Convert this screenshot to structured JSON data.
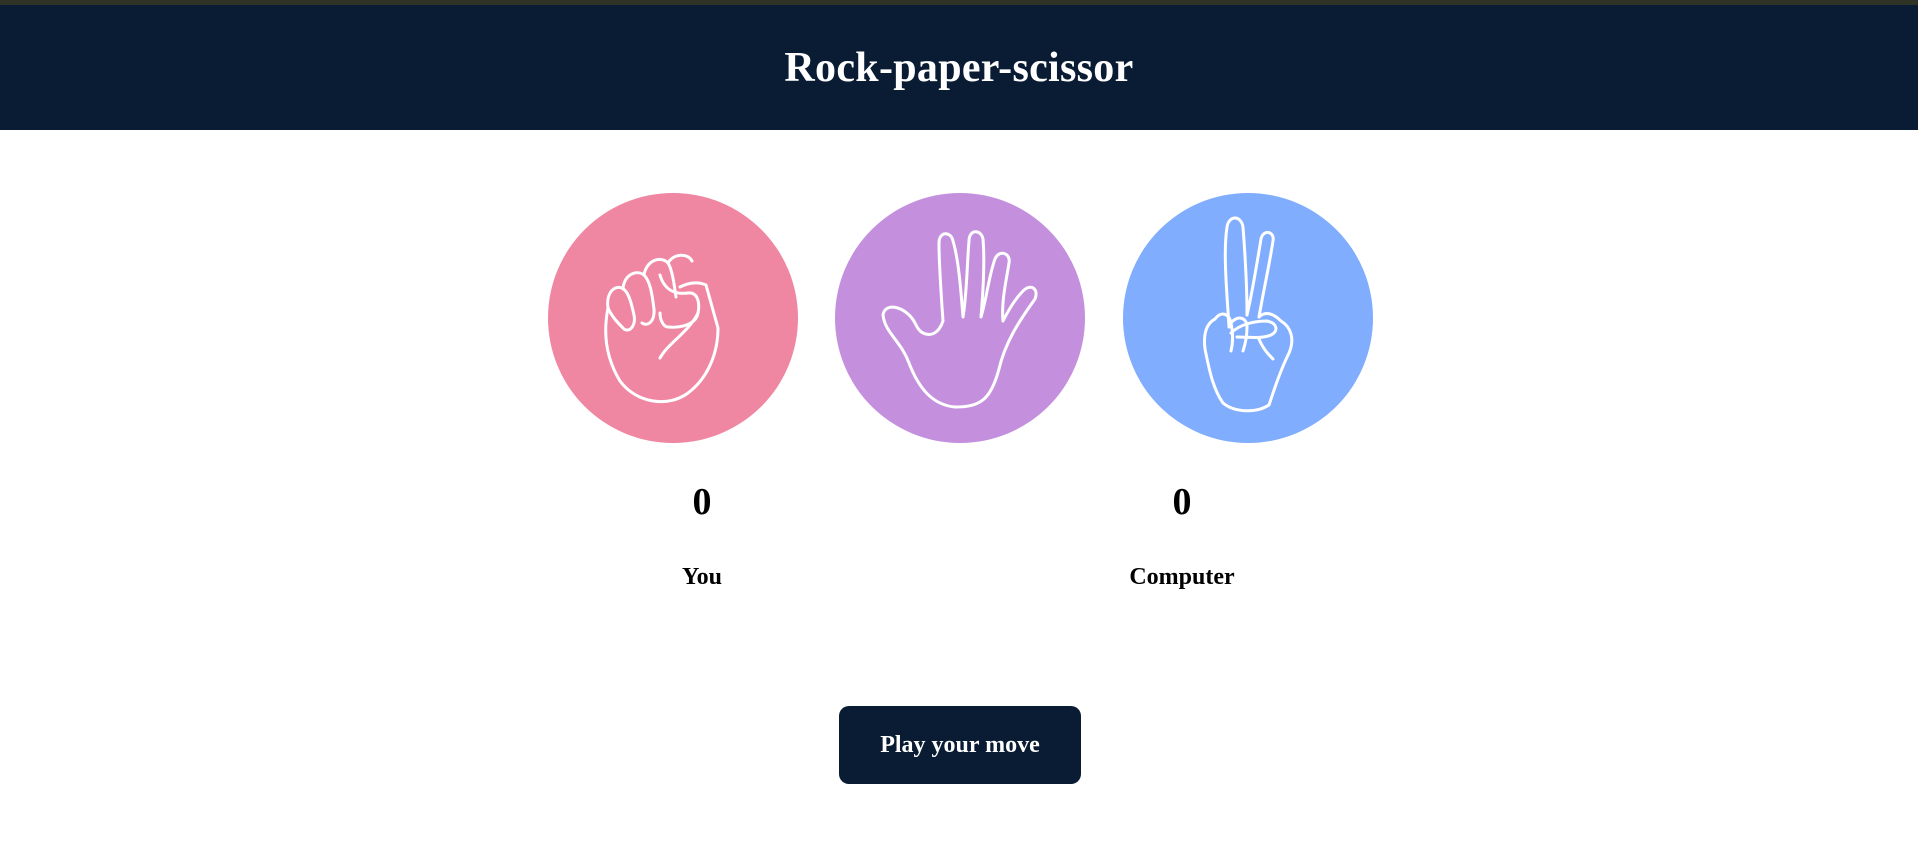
{
  "header": {
    "title": "Rock-paper-scissor"
  },
  "choices": [
    {
      "name": "rock",
      "icon": "fist-icon",
      "color": "#f087a2"
    },
    {
      "name": "paper",
      "icon": "open-hand-icon",
      "color": "#c490de"
    },
    {
      "name": "scissor",
      "icon": "peace-hand-icon",
      "color": "#80adfe"
    }
  ],
  "scoreboard": {
    "user_score": "0",
    "user_label": "You",
    "computer_score": "0",
    "computer_label": "Computer"
  },
  "message": {
    "button_label": "Play your move"
  },
  "colors": {
    "header_bg": "#0a1c34",
    "button_bg": "#0a1c34"
  }
}
